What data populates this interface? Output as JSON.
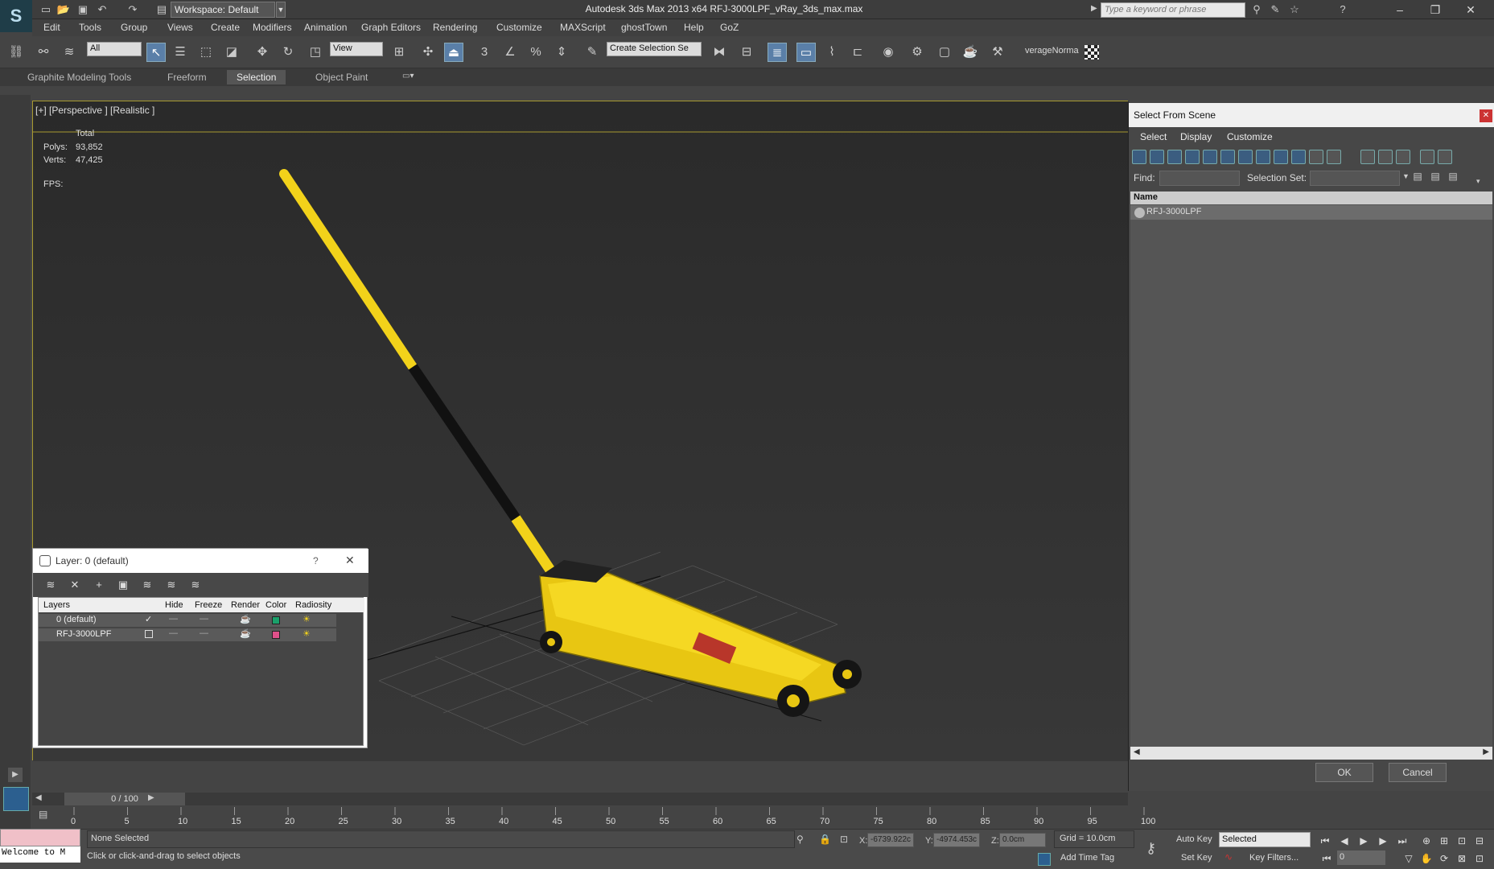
{
  "app": {
    "title": "Autodesk 3ds Max  2013 x64      RFJ-3000LPF_vRay_3ds_max.max",
    "workspace": "Workspace: Default",
    "search_placeholder": "Type a keyword or phrase"
  },
  "menus": [
    "Edit",
    "Tools",
    "Group",
    "Views",
    "Create",
    "Modifiers",
    "Animation",
    "Graph Editors",
    "Rendering",
    "Customize",
    "MAXScript",
    "ghostTown",
    "Help",
    "GoZ"
  ],
  "toolbar": {
    "filter_value": "All",
    "refcoord_value": "View",
    "selection_set_value": "Create Selection Se",
    "custom_label": "verageNorma"
  },
  "ribbon": {
    "tabs": [
      "Graphite Modeling Tools",
      "Freeform",
      "Selection",
      "Object Paint"
    ],
    "active": "Selection"
  },
  "viewport": {
    "label": "[+] [Perspective ] [Realistic ]",
    "stats": {
      "header": "Total",
      "polys_label": "Polys:",
      "polys": "93,852",
      "verts_label": "Verts:",
      "verts": "47,425",
      "fps_label": "FPS:"
    }
  },
  "select_from_scene": {
    "title": "Select From Scene",
    "menu": [
      "Select",
      "Display",
      "Customize"
    ],
    "find_label": "Find:",
    "selection_set_label": "Selection Set:",
    "column_name": "Name",
    "items": [
      "RFJ-3000LPF"
    ],
    "ok": "OK",
    "cancel": "Cancel"
  },
  "layer_window": {
    "title": "Layer: 0 (default)",
    "help": "?",
    "columns": [
      "Layers",
      "Hide",
      "Freeze",
      "Render",
      "Color",
      "Radiosity"
    ],
    "rows": [
      {
        "name": "0 (default)",
        "color": "#1aa06a"
      },
      {
        "name": "RFJ-3000LPF",
        "color": "#e0508a"
      }
    ]
  },
  "timeline": {
    "slider": "0 / 100",
    "ticks": [
      "0",
      "5",
      "10",
      "15",
      "20",
      "25",
      "30",
      "35",
      "40",
      "45",
      "50",
      "55",
      "60",
      "65",
      "70",
      "75",
      "80",
      "85",
      "90",
      "95",
      "100"
    ]
  },
  "status": {
    "listener": "Welcome to M",
    "selection": "None Selected",
    "prompt": "Click or click-and-drag to select objects",
    "x_label": "X:",
    "x": "-6739.922c",
    "y_label": "Y:",
    "y": "-4974.453c",
    "z_label": "Z:",
    "z": "0.0cm",
    "grid": "Grid = 10.0cm",
    "add_time_tag": "Add Time Tag",
    "auto_key": "Auto Key",
    "set_key": "Set Key",
    "key_mode": "Selected",
    "key_filters": "Key Filters...",
    "frame": "0"
  },
  "colors": {
    "viewport_border": "#a89a30",
    "jack_yellow": "#f2d21a",
    "active_tool": "#5a7fa8"
  }
}
